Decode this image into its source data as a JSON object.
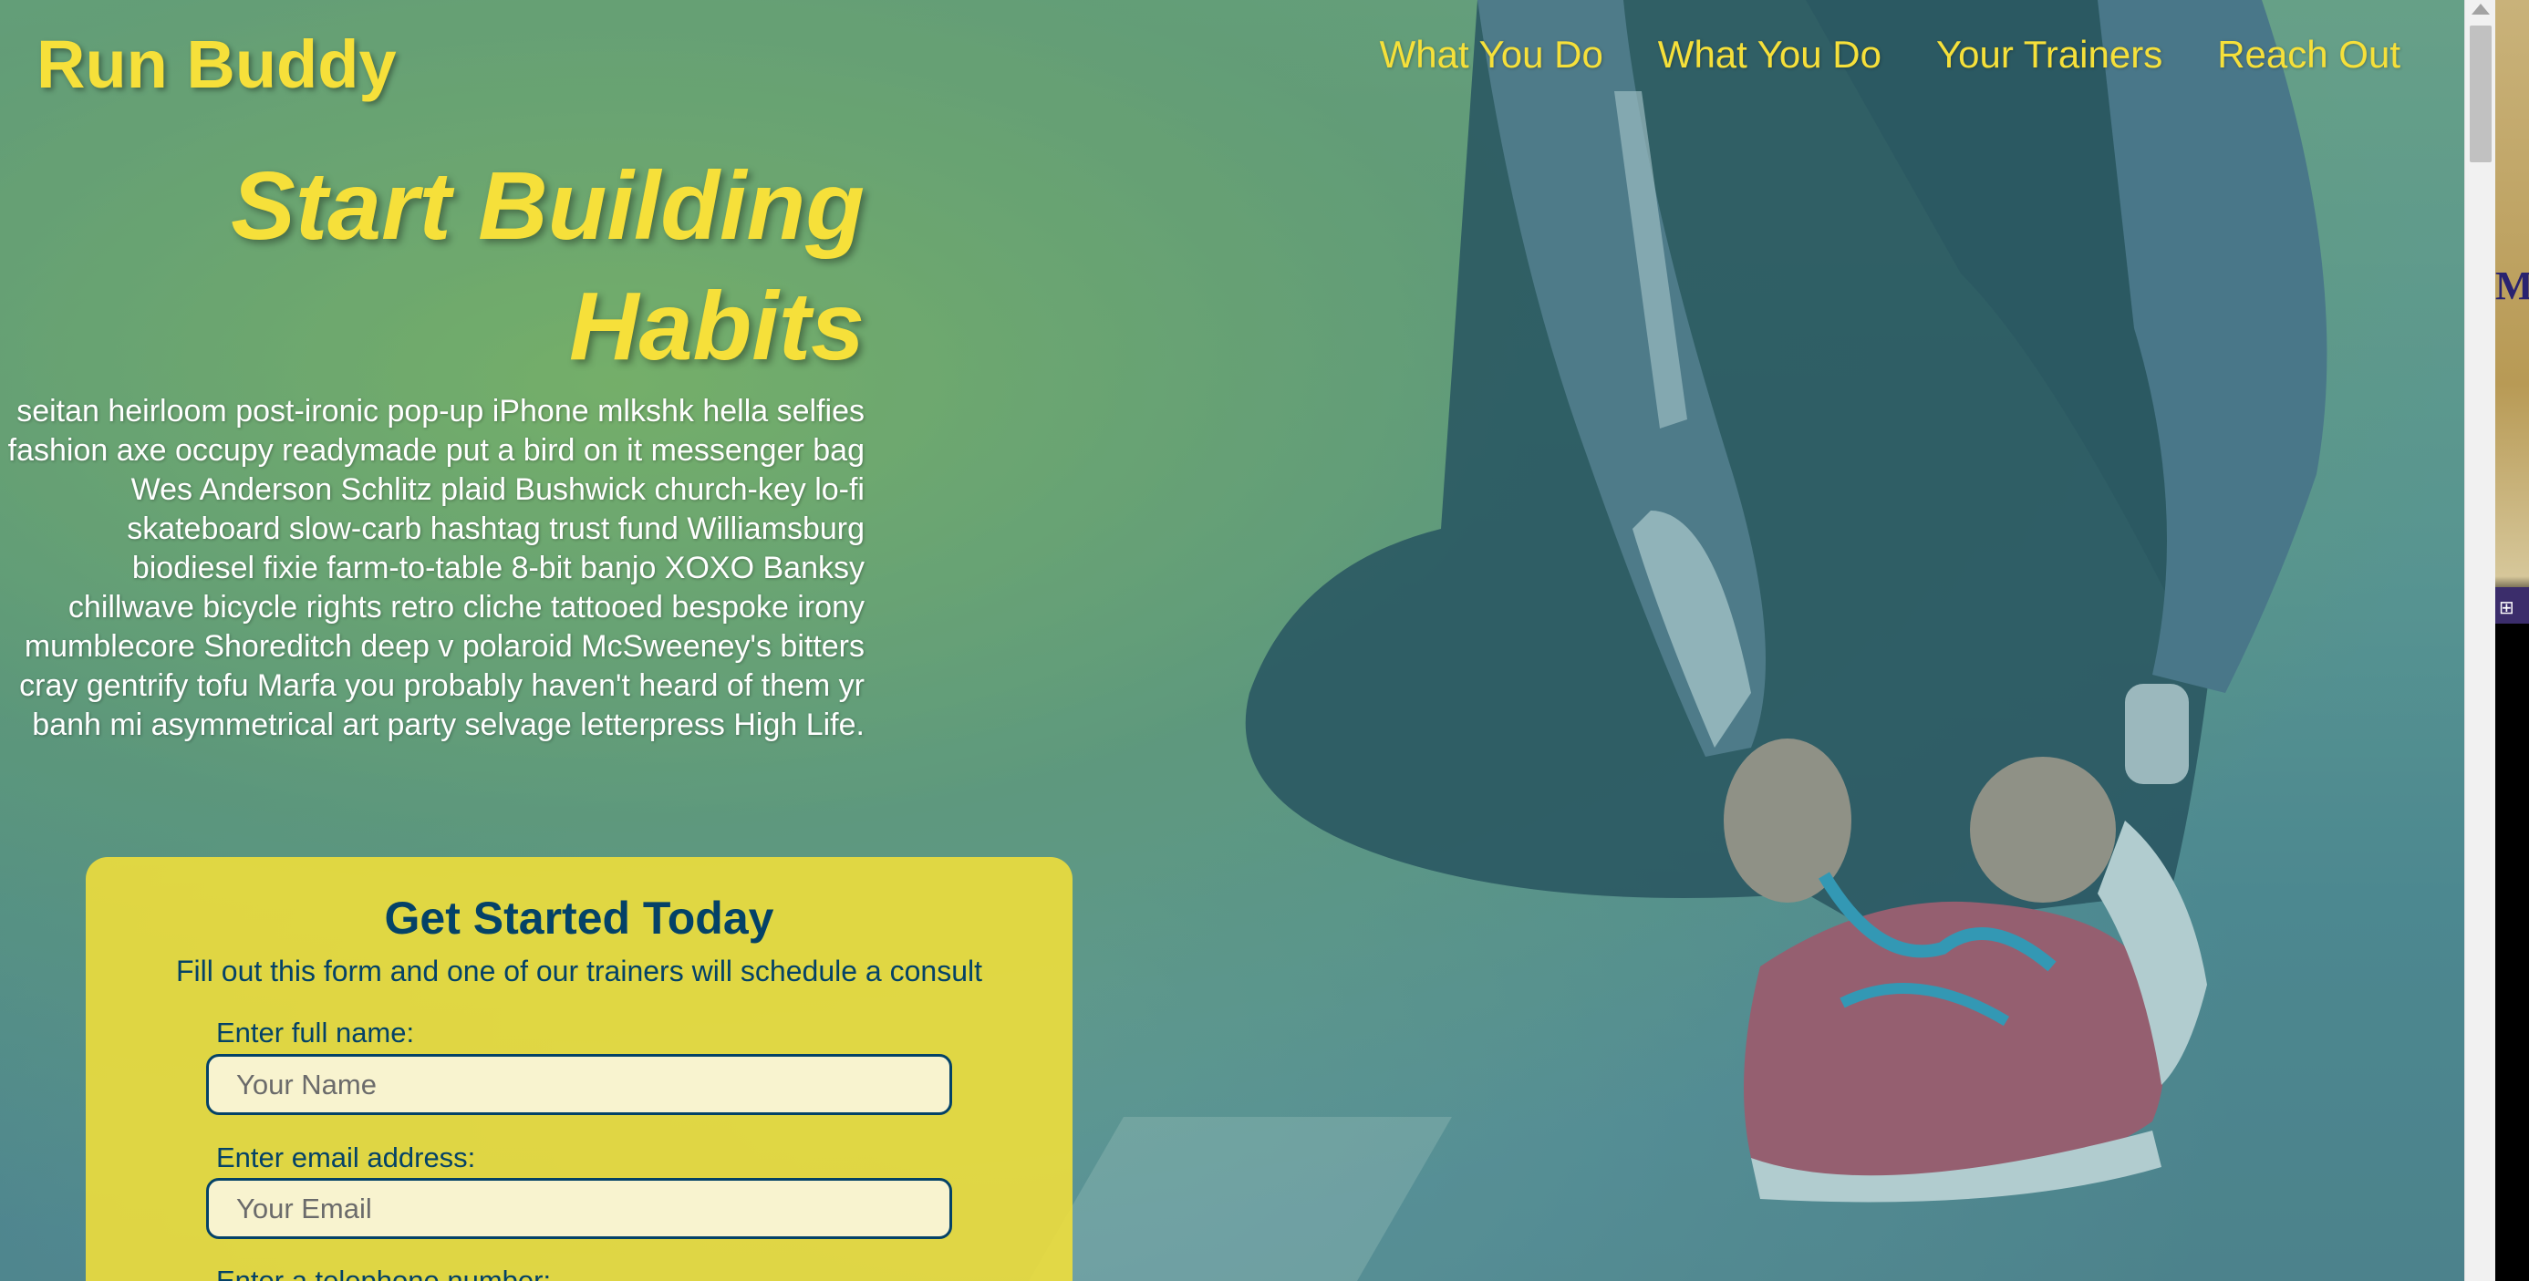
{
  "header": {
    "logo": "Run Buddy",
    "nav": [
      "What You Do",
      "What You Do",
      "Your Trainers",
      "Reach Out"
    ]
  },
  "hero": {
    "title_line1": "Start Building",
    "title_line2": "Habits",
    "body": "seitan heirloom post-ironic pop-up iPhone mlkshk hella selfies fashion axe occupy readymade put a bird on it messenger bag Wes Anderson Schlitz plaid Bushwick church-key lo-fi skateboard slow-carb hashtag trust fund Williamsburg biodiesel fixie farm-to-table 8-bit banjo XOXO Banksy chillwave bicycle rights retro cliche tattooed bespoke irony mumblecore Shoreditch deep v polaroid McSweeney's bitters cray gentrify tofu Marfa you probably haven't heard of them yr banh mi asymmetrical art party selvage letterpress High Life."
  },
  "form": {
    "title": "Get Started Today",
    "subtitle": "Fill out this form and one of our trainers will schedule a consult",
    "name_label": "Enter full name:",
    "name_placeholder": "Your Name",
    "email_label": "Enter email address:",
    "email_placeholder": "Your Email",
    "phone_label": "Enter a telephone number:"
  },
  "right_window": {
    "letter": "M"
  },
  "colors": {
    "accent_yellow": "#f6e03a",
    "dark_blue": "#044267",
    "card_yellow": "#eede3c"
  }
}
